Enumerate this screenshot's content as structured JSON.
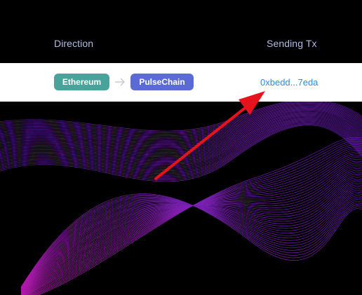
{
  "table": {
    "headers": {
      "direction": "Direction",
      "sending_tx": "Sending Tx"
    },
    "row": {
      "from_chain": "Ethereum",
      "to_chain": "PulseChain",
      "sending_tx": "0xbedd...7eda"
    }
  },
  "colors": {
    "from_chip": "#4aa39b",
    "to_chip": "#5a6bd6",
    "link": "#2f86e6",
    "annotation_arrow": "#e8121c",
    "wave_purple": "#8a1fd8",
    "wave_magenta": "#c21fe0"
  },
  "icons": {
    "separator": "arrow-right-icon",
    "annotation": "annotation-arrow"
  }
}
